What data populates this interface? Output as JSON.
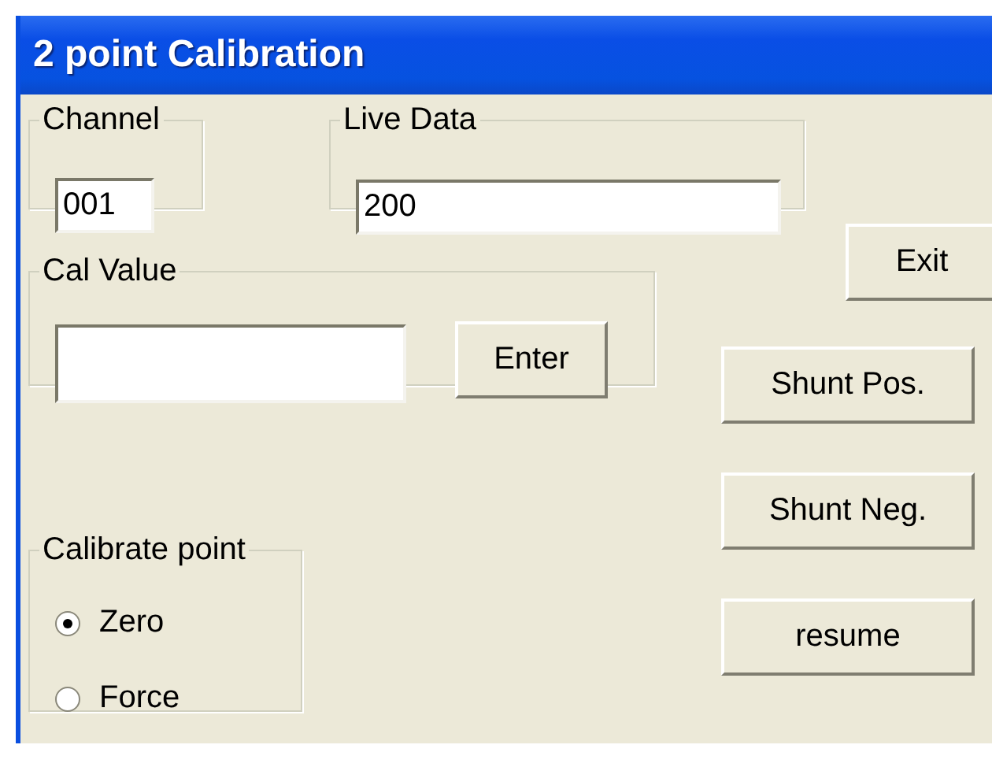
{
  "window": {
    "title": "2 point Calibration"
  },
  "channel": {
    "label": "Channel",
    "value": "001"
  },
  "live_data": {
    "label": "Live Data",
    "value": "200"
  },
  "cal_value": {
    "label": "Cal Value",
    "button": "Enter"
  },
  "calibrate_point": {
    "label": "Calibrate point",
    "options": [
      {
        "label": "Zero",
        "selected": true
      },
      {
        "label": "Force",
        "selected": false
      }
    ]
  },
  "buttons": [
    "Exit",
    "Shunt Pos.",
    "Shunt Neg.",
    "resume"
  ]
}
